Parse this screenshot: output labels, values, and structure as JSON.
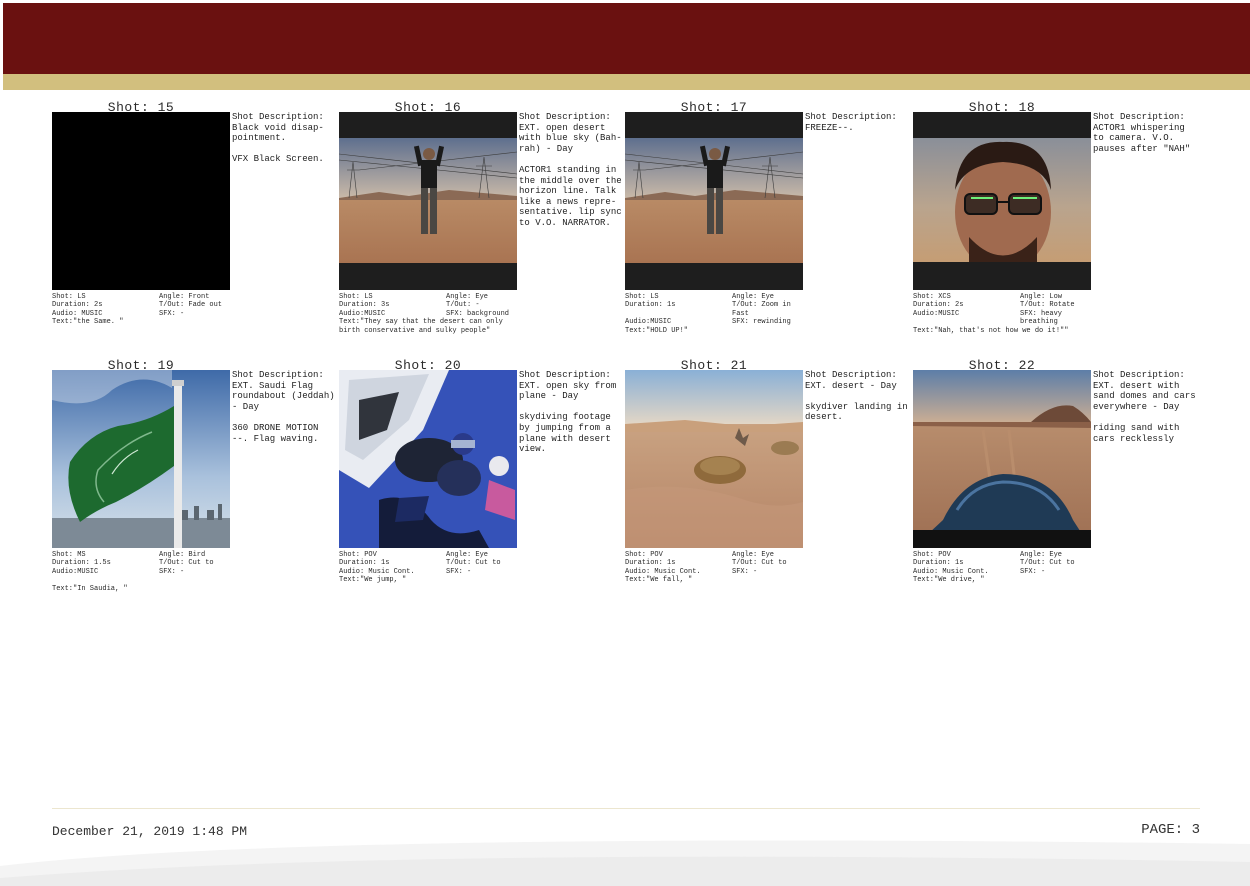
{
  "colors": {
    "header": "#6a1110",
    "gold_band": "#d2bf7e"
  },
  "shots": [
    {
      "title": "Shot: 15",
      "description": "Shot Description:\nBlack void disap-\npointment.\n\nVFX Black Screen.",
      "image": "black-screen",
      "shot": "Shot: LS",
      "angle": "Angle: Front",
      "duration": "Duration: 2s",
      "tout": "T/Out: Fade out",
      "audio": "Audio: MUSIC",
      "sfx": "SFX: -",
      "text": "Text:\"the Same. \""
    },
    {
      "title": "Shot: 16",
      "description": "Shot Description:\nEXT. open desert\nwith blue sky (Bah-\nrah) - Day\n\nACTOR1 standing in\nthe middle over the\nhorizon line. Talk\nlike a news repre-\nsentative. lip sync\nto V.O. NARRATOR.",
      "image": "man-desert",
      "shot": "Shot: LS",
      "angle": "Angle: Eye",
      "duration": "Duration: 3s",
      "tout": "T/Out: -",
      "audio": "Audio:MUSIC",
      "sfx": "SFX: background",
      "text": "Text:\"They say that the desert can only\nbirth conservative and sulky people\""
    },
    {
      "title": "Shot: 17",
      "description": "Shot Description:\nFREEZE--.",
      "image": "man-desert",
      "shot": "Shot: LS",
      "angle": "Angle: Eye",
      "duration": "Duration: 1s",
      "tout": "T/Out: Zoom in\n        Fast",
      "audio": "Audio:MUSIC",
      "sfx": "SFX: rewinding",
      "text": "Text:\"HOLD UP!\""
    },
    {
      "title": "Shot: 18",
      "description": "Shot Description:\nACTOR1 whispering\nto camera. V.O.\npauses after \"NAH\"",
      "image": "face-closeup",
      "shot": "Shot: XCS",
      "angle": "Angle: Low",
      "duration": "Duration: 2s",
      "tout": "T/Out: Rotate",
      "audio": "Audio:MUSIC",
      "sfx": "SFX: heavy\n        breathing",
      "text": "Text:\"Nah, that's not how we do it!\"\""
    },
    {
      "title": "Shot: 19",
      "description": "Shot Description:\nEXT. Saudi Flag\nroundabout (Jeddah)\n- Day\n\n360 DRONE MOTION\n--. Flag waving.",
      "image": "flag",
      "shot": "Shot: MS",
      "angle": "Angle: Bird",
      "duration": "Duration: 1.5s",
      "tout": "T/Out: Cut to",
      "audio": "Audio:MUSIC",
      "sfx": "SFX: -",
      "text": "\nText:\"In Saudia, \""
    },
    {
      "title": "Shot: 20",
      "description": "Shot Description:\nEXT. open sky from\nplane - Day\n\nskydiving footage\nby jumping from a\nplane with desert\nview.",
      "image": "skydive",
      "shot": "Shot: POV",
      "angle": "Angle: Eye",
      "duration": "Duration: 1s",
      "tout": "T/Out: Cut to",
      "audio": "Audio: Music Cont.",
      "sfx": "SFX: -",
      "text": "Text:\"We jump, \""
    },
    {
      "title": "Shot: 21",
      "description": "Shot Description:\nEXT. desert - Day\n\nskydiver landing in\ndesert.",
      "image": "desert-landing",
      "shot": "Shot: POV",
      "angle": "Angle: Eye",
      "duration": "Duration: 1s",
      "tout": "T/Out: Cut to",
      "audio": "Audio: Music Cont.",
      "sfx": "SFX: -",
      "text": "Text:\"We fall, \""
    },
    {
      "title": "Shot: 22",
      "description": "Shot Description:\nEXT. desert with\nsand domes and cars\neverywhere - Day\n\nriding sand with\ncars recklessly",
      "image": "car-desert",
      "shot": "Shot: POV",
      "angle": "Angle: Eye",
      "duration": "Duration: 1s",
      "tout": "T/Out: Cut to",
      "audio": "Audio: Music Cont.",
      "sfx": "SFX: -",
      "text": "Text:\"We drive, \""
    }
  ],
  "footer": {
    "date": "December 21, 2019 1:48 PM",
    "page": "PAGE: 3"
  }
}
